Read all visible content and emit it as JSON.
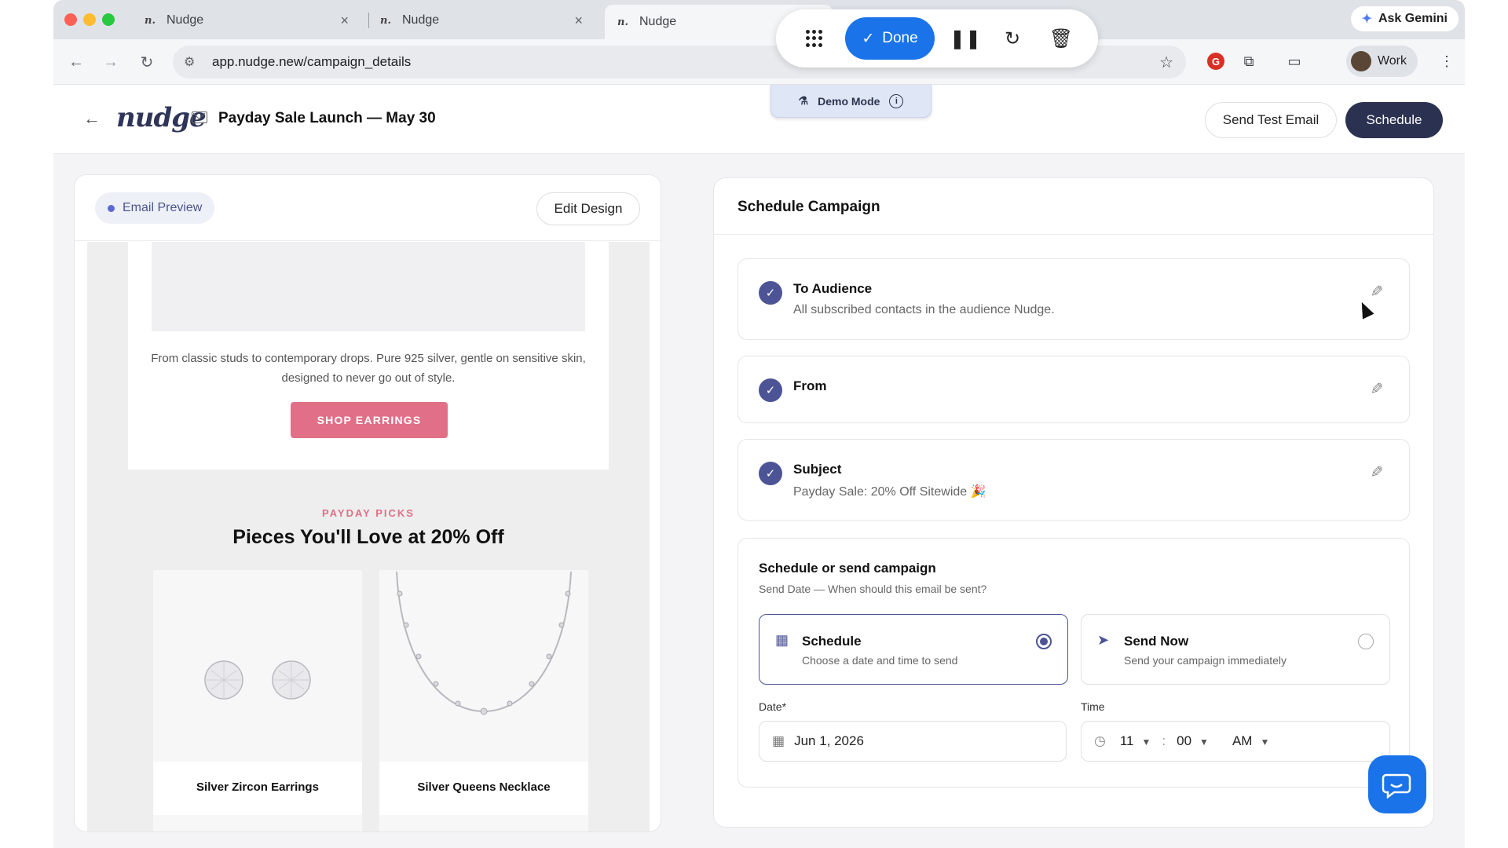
{
  "browser": {
    "tabs": [
      {
        "title": "Nudge"
      },
      {
        "title": "Nudge"
      },
      {
        "title": "Nudge"
      }
    ],
    "url": "app.nudge.new/campaign_details",
    "ask_gemini": "Ask Gemini",
    "profile_name": "Work"
  },
  "recorder": {
    "done_label": "Done"
  },
  "demo_mode": {
    "label": "Demo Mode"
  },
  "header": {
    "logo": "nudge",
    "campaign_title": "Payday Sale Launch — May 30",
    "send_test_label": "Send Test Email",
    "schedule_label": "Schedule"
  },
  "preview": {
    "chip_label": "Email Preview",
    "edit_design_label": "Edit Design",
    "description": "From classic studs to contemporary drops. Pure 925 silver, gentle on sensitive skin, designed to never go out of style.",
    "cta_label": "SHOP EARRINGS",
    "eyebrow": "PAYDAY PICKS",
    "section_title": "Pieces You'll Love at 20% Off",
    "products": [
      {
        "name": "Silver Zircon Earrings"
      },
      {
        "name": "Silver Queens Necklace"
      }
    ]
  },
  "schedule": {
    "title": "Schedule Campaign",
    "steps": [
      {
        "title": "To Audience",
        "subtitle": "All subscribed contacts in the audience Nudge."
      },
      {
        "title": "From",
        "subtitle": ""
      },
      {
        "title": "Subject",
        "subtitle": "Payday Sale: 20% Off Sitewide 🎉"
      }
    ],
    "send_block": {
      "title": "Schedule or send campaign",
      "subtitle": "Send Date — When should this email be sent?",
      "options": [
        {
          "title": "Schedule",
          "subtitle": "Choose a date and time to send",
          "selected": true
        },
        {
          "title": "Send Now",
          "subtitle": "Send your campaign immediately",
          "selected": false
        }
      ],
      "date_label": "Date*",
      "date_value": "Jun 1, 2026",
      "time_label": "Time",
      "hour": "11",
      "minute": "00",
      "ampm": "AM",
      "time_separator": ":"
    }
  },
  "colors": {
    "brand_navy": "#2b3151",
    "accent_indigo": "#4c5496",
    "cta_pink": "#e06f87",
    "chrome_blue": "#1a73e8"
  }
}
